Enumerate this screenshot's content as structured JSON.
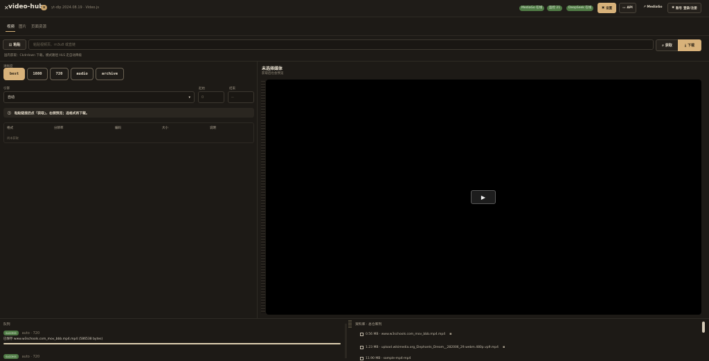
{
  "header": {
    "title": "video-hub",
    "version_badge": "v",
    "subtitle": "yt-dlp 2024.08.19 · Video.js",
    "status_pills": [
      "MediaGo 在线",
      "监控 21",
      "DeepSeek 在线"
    ],
    "button_settings": "设置",
    "button_api": "API",
    "link_mediago": "MediaGo",
    "button_login": "账号",
    "login_sub": "登录/注册"
  },
  "tabs": [
    "视频",
    "图片",
    "页面资源"
  ],
  "url_bar": {
    "paste_label": "粘贴",
    "placeholder": "粘贴视频页、m3u8 或直链",
    "fetch_label": "获取",
    "download_label": "下载",
    "hint": "国内获取：Ckdrdown 下载，模式路径 HLS 走自动降级"
  },
  "left": {
    "preset_label": "清晰度",
    "presets": [
      "best",
      "1080",
      "720",
      "audio",
      "archive"
    ],
    "active_preset": "best",
    "engine_label": "引擎",
    "engine_value": "自动",
    "start_label": "起始",
    "start_placeholder": "0",
    "end_label": "结束",
    "end_placeholder": "--",
    "notice": "粘贴链接后点「获取」，右侧预览；选格式再下载。",
    "table_headers": [
      "格式",
      "分辨率",
      "编码",
      "大小",
      "说明"
    ],
    "table_empty": "尚未获取"
  },
  "preview": {
    "title": "未选择媒体",
    "subtitle": "获取后也会预览"
  },
  "queue": {
    "title": "队列",
    "items": [
      {
        "status": "success",
        "meta": "auto · 720",
        "line": "已保存 www.w3schools.com_mov_bbb.mp4.mp4 (586538 bytes)",
        "progress": 1.0
      },
      {
        "status": "success",
        "meta": "auto · 720",
        "line": "",
        "progress": 0
      }
    ]
  },
  "library": {
    "title": "资料库 · 总仓库列",
    "items": [
      {
        "text": "0.56 MB · www.w3schools.com_mov_bbb.mp4.mp4"
      },
      {
        "text": "1.23 MB · upload.wikimedia.org_Elephants_Dream__282006_29.webm.480p.vp9.mp4"
      },
      {
        "text": "11.90 MB · sample-mp4-mp4"
      }
    ]
  },
  "colors": {
    "accent": "#d8b27a",
    "success": "#4f7a45",
    "bg": "#1d1a16"
  }
}
